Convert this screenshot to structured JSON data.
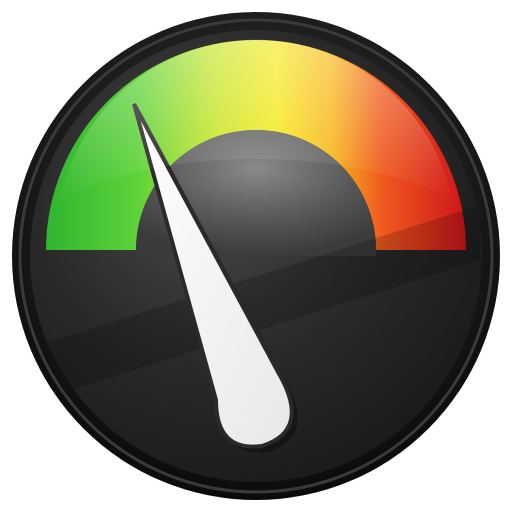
{
  "gauge": {
    "type": "speedometer-icon",
    "level": 0.18,
    "colors": {
      "bezel": "#1c1c1c",
      "face": "#2a2a2a",
      "low": "#3fbf3f",
      "mid": "#f2e22a",
      "high": "#d8201a",
      "needle": "#ffffff",
      "hub": "#6e6e6e"
    }
  }
}
